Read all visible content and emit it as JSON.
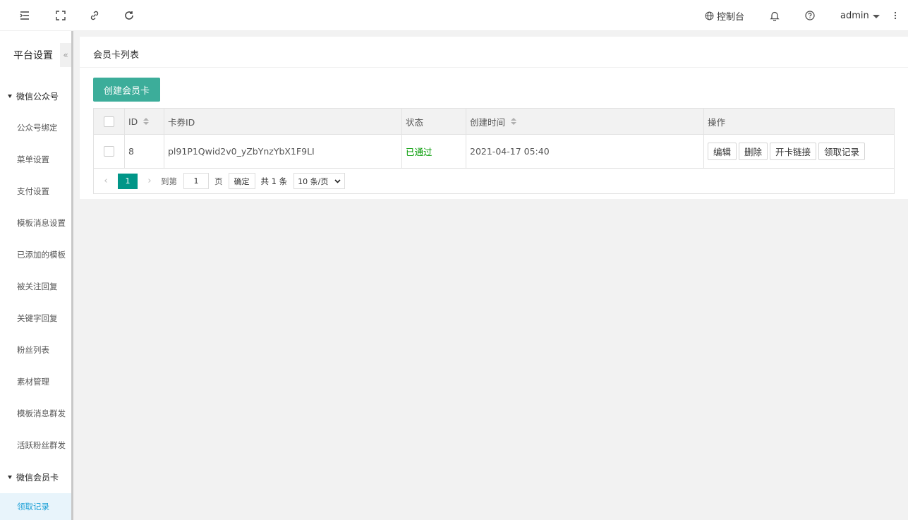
{
  "header": {
    "icons": [
      "menu-fold-icon",
      "fullscreen-icon",
      "link-icon",
      "refresh-icon"
    ],
    "console_label": "控制台",
    "user_label": "admin"
  },
  "sidebar": {
    "title": "平台设置",
    "collapse_glyph": "«",
    "groups": [
      {
        "label": "微信公众号",
        "items": [
          "公众号绑定",
          "菜单设置",
          "支付设置",
          "模板消息设置",
          "已添加的模板",
          "被关注回复",
          "关键字回复",
          "粉丝列表",
          "素材管理",
          "模板消息群发",
          "活跃粉丝群发"
        ]
      },
      {
        "label": "微信会员卡",
        "items": [
          "领取记录"
        ]
      }
    ],
    "active_item": "领取记录"
  },
  "main": {
    "title": "会员卡列表",
    "create_button": "创建会员卡",
    "table": {
      "columns": [
        "ID",
        "卡券ID",
        "状态",
        "创建时间",
        "操作"
      ],
      "rows": [
        {
          "id": "8",
          "card_id": "pl91P1Qwid2v0_yZbYnzYbX1F9LI",
          "status": "已通过",
          "created": "2021-04-17 05:40",
          "actions": [
            "编辑",
            "删除",
            "开卡链接",
            "领取记录"
          ]
        }
      ]
    },
    "pagination": {
      "prev": "‹",
      "current_page": "1",
      "next": "›",
      "goto_label": "到第",
      "goto_value": "1",
      "page_unit": "页",
      "confirm": "确定",
      "total": "共 1 条",
      "page_size": "10 条/页"
    }
  },
  "colors": {
    "primary": "#3cad9a",
    "pager_active": "#009688",
    "status_ok": "#009a00",
    "sidebar_active_text": "#1a9fd6"
  }
}
